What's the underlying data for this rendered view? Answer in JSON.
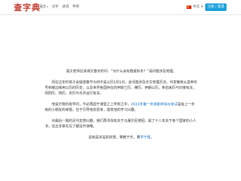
{
  "header": {
    "logo": "查字典",
    "nav": [
      {
        "label": "语文",
        "caret": "▾"
      },
      {
        "label": "汉字",
        "caret": ""
      },
      {
        "label": "诗词",
        "caret": ""
      },
      {
        "label": "学校",
        "caret": ""
      }
    ],
    "language": {
      "label": "中文",
      "caret": "▾",
      "flag": "china-flag-icon"
    },
    "login_label": "注册 / 登录"
  },
  "article": {
    "p1": "语文老师在讲课文春天时问：“为什么会有春夏秋冬？”请问题涉及地理。",
    "p2": "而在过年时孩子会疑惑春节为何不是公历1月1日，此问题涉及天文地理历法，可发散到从皇帝年号到被边缘用公历的历史，以及世界各国存在的伊斯兰历、佛历、伊朗公历，希伯来历与印度有关，而阳历、阴历、农历与日月运行有关。",
    "p3_prefix": "他说万物均有学问，不必再因于课堂之上学校之中，",
    "p3_link": "2022年暑一年级期末综合考试",
    "p3_suffix": "是给上一年级的小朋友的考题，在于引导他去思考，激发他的学习兴趣。",
    "p4": "对最后一题的近代史感兴趣，我们再寻找有关于马戛尔尼使团，属了十八本关于各个国家的小人书，估五本章先写了都没开演哦。",
    "p5_prefix": "这就是本站的初衷，寓教于乐，寓",
    "p5_link": "学于题",
    "p5_suffix": "。"
  }
}
